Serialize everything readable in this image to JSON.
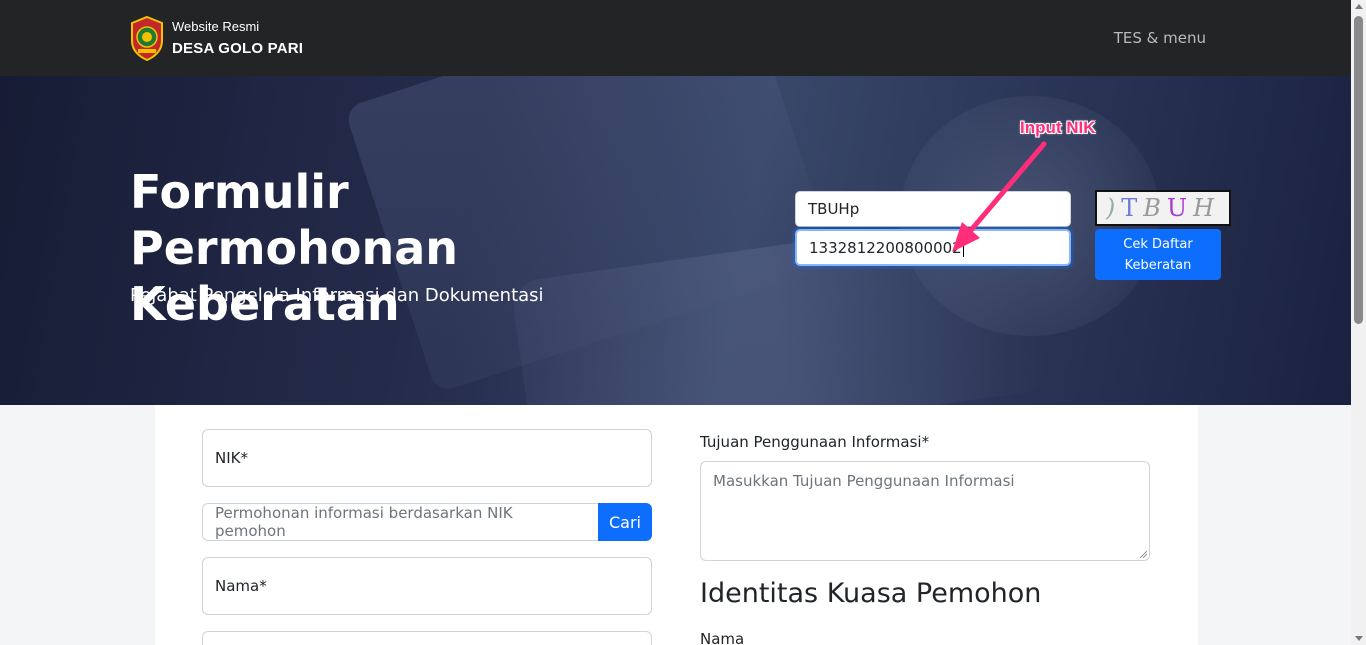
{
  "navbar": {
    "brand_sub": "Website Resmi",
    "brand_name": "DESA GOLO PARI",
    "menu_label": "TES & menu"
  },
  "hero": {
    "title": "Formulir Permohonan Keberatan",
    "subtitle": "Pejabat Pengelola Informasi dan Dokumentasi",
    "captcha_value": "TBUHp",
    "captcha_text": "TBUHp",
    "nik_value": "1332812200800002",
    "check_button": "Cek Daftar Keberatan",
    "annotation": "Input NIK",
    "annotation_color": "#ff2d7a"
  },
  "form": {
    "nik_placeholder": "NIK*",
    "search_placeholder": "Permohonan informasi berdasarkan NIK pemohon",
    "search_button": "Cari",
    "nama_placeholder": "Nama*",
    "tujuan_label": "Tujuan Penggunaan Informasi*",
    "tujuan_placeholder": "Masukkan Tujuan Penggunaan Informasi",
    "kuasa_title": "Identitas Kuasa Pemohon",
    "kuasa_nama_label": "Nama"
  },
  "colors": {
    "primary": "#0d6efd",
    "navbar_bg": "#232425"
  }
}
